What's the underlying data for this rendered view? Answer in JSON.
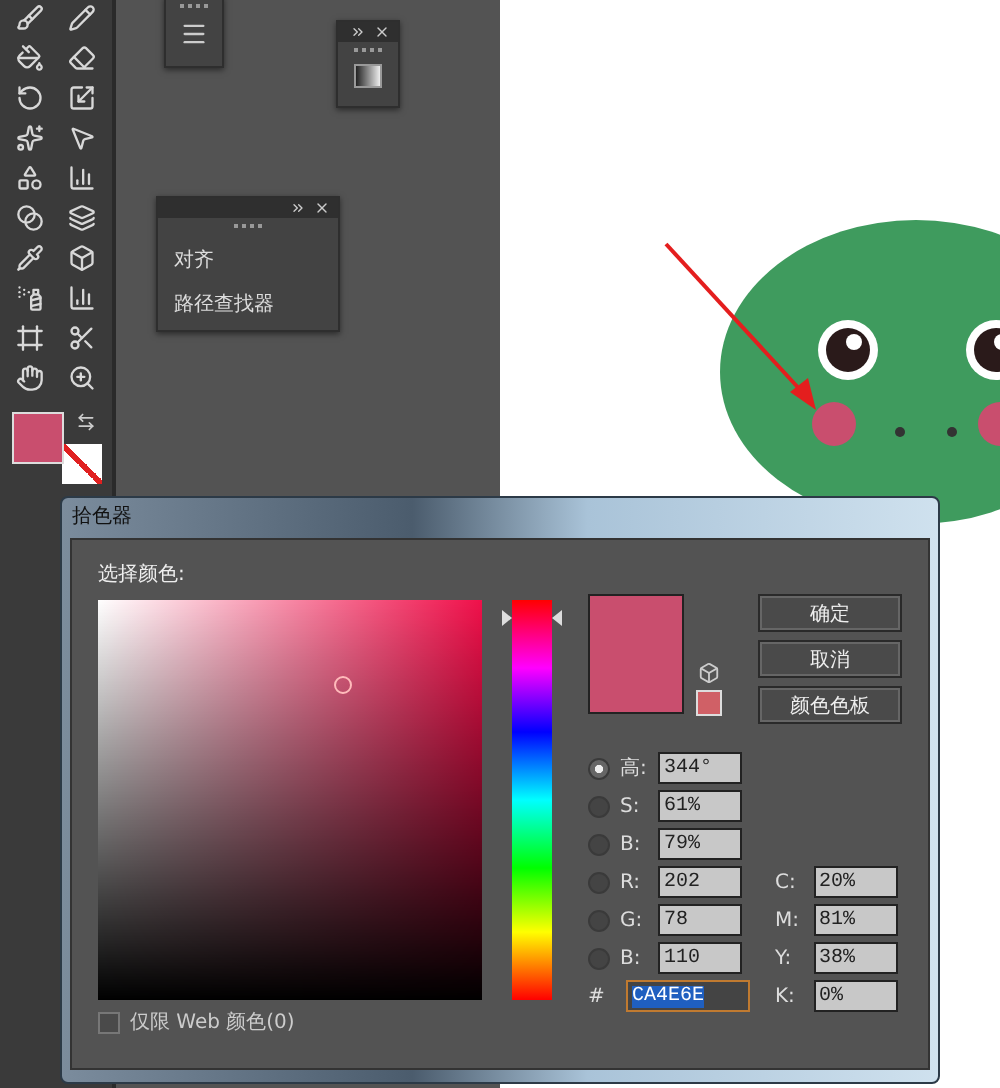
{
  "panels": [
    {
      "items": [
        {
          "label": "对齐"
        },
        {
          "label": "路径查找器"
        }
      ]
    }
  ],
  "color_picker": {
    "title": "拾色器",
    "section_label": "选择颜色:",
    "hue": {
      "level": 0.955
    },
    "buttons": [
      "确定",
      "取消",
      "颜色色板"
    ],
    "hsb_rgb": [
      {
        "label": "高:",
        "value": "344°",
        "selected": true
      },
      {
        "label": "S:",
        "value": "61%",
        "selected": false
      },
      {
        "label": "B:",
        "value": "79%",
        "selected": false
      },
      {
        "label": "R:",
        "value": "202",
        "selected": false
      },
      {
        "label": "G:",
        "value": "78",
        "selected": false
      },
      {
        "label": "B:",
        "value": "110",
        "selected": false
      }
    ],
    "cmyk": [
      {
        "label": "C:",
        "value": "20%"
      },
      {
        "label": "M:",
        "value": "81%"
      },
      {
        "label": "Y:",
        "value": "38%"
      },
      {
        "label": "K:",
        "value": "0%"
      }
    ],
    "hex": {
      "label": "#",
      "value": "CA4E6E"
    },
    "web_only": {
      "label": "仅限 Web 颜色(0)",
      "checked": false
    }
  }
}
